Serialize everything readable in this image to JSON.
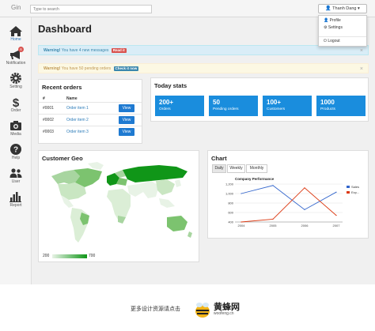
{
  "app": {
    "brand": "Gin"
  },
  "topbar": {
    "search_placeholder": "Type to search",
    "user_name": "Thanh Dang",
    "user_menu": {
      "profile": "Profile",
      "settings": "Settings",
      "logout": "Logout"
    }
  },
  "sidebar": {
    "items": [
      {
        "label": "Home",
        "icon": "home-icon",
        "active": true
      },
      {
        "label": "Notification",
        "icon": "bullhorn-icon",
        "badge": "6"
      },
      {
        "label": "Setting",
        "icon": "gear-icon"
      },
      {
        "label": "Order",
        "icon": "dollar-icon"
      },
      {
        "label": "Media",
        "icon": "camera-icon"
      },
      {
        "label": "Help",
        "icon": "question-icon"
      },
      {
        "label": "User",
        "icon": "users-icon"
      },
      {
        "label": "Report",
        "icon": "bar-chart-icon"
      }
    ]
  },
  "main": {
    "title": "Dashboard",
    "alerts": [
      {
        "strong": "Warning!",
        "text": " You have 4 new messages",
        "label": "Read it",
        "label_color": "#d9534f",
        "close": "×"
      },
      {
        "strong": "Warning!",
        "text": " You have 50 pending orders",
        "label": "Check it now",
        "label_color": "#3a87ad",
        "close": "×"
      }
    ]
  },
  "recent_orders": {
    "title": "Recent orders",
    "headers": [
      "#",
      "Name"
    ],
    "rows": [
      {
        "id": "#0001",
        "name": "Order item 1",
        "action": "View"
      },
      {
        "id": "#0002",
        "name": "Order item 2",
        "action": "View"
      },
      {
        "id": "#0003",
        "name": "Order item 3",
        "action": "View"
      }
    ]
  },
  "today_stats": {
    "title": "Today stats",
    "items": [
      {
        "value": "200+",
        "label": "Orders"
      },
      {
        "value": "50",
        "label": "Pending orders"
      },
      {
        "value": "100+",
        "label": "Customers"
      },
      {
        "value": "1000",
        "label": "Products"
      }
    ]
  },
  "customer_geo": {
    "title": "Customer Geo",
    "legend_min": "200",
    "legend_max": "700"
  },
  "chart_panel": {
    "title": "Chart",
    "tabs": [
      "Daily",
      "Weekly",
      "Monthly"
    ],
    "active_tab": "Daily"
  },
  "chart_data": {
    "type": "line",
    "title": "Company Performance",
    "x": [
      "2004",
      "2005",
      "2006",
      "2007"
    ],
    "ylim": [
      400,
      1200
    ],
    "yticks": [
      "1,200",
      "1,000",
      "800",
      "600",
      "400"
    ],
    "grid": true,
    "legend_position": "right",
    "series": [
      {
        "name": "Sales",
        "color": "#3366cc",
        "values": [
          1000,
          1170,
          660,
          1030
        ]
      },
      {
        "name": "Exp...",
        "color": "#dc3912",
        "values": [
          400,
          460,
          1120,
          540
        ]
      }
    ]
  },
  "footer": {
    "text": "更多设计资源请点击",
    "brand": "黄蜂网",
    "url": "woofeng.cn"
  },
  "colors": {
    "primary": "#1f7ad1",
    "stat_tile": "#1a8ddd",
    "map_dark": "#109618",
    "map_light": "#c8e6c0"
  }
}
